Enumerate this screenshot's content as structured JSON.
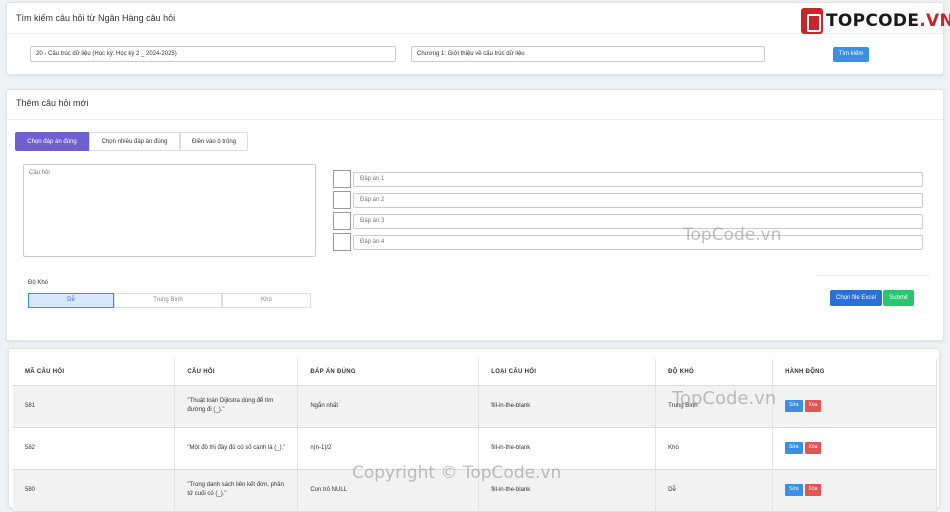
{
  "search": {
    "title": "Tìm kiếm câu hỏi từ Ngân Hàng câu hỏi",
    "course": "20 - Cấu trúc dữ liệu (Học kỳ: Học kỳ 2 _ 2024-2025)",
    "chapter": "Chương 1: Giới thiệu về cấu trúc dữ liệu",
    "button": "Tìm kiếm"
  },
  "logo": {
    "text_main": "TOPCODE",
    "text_suffix": ".VN"
  },
  "add_question": {
    "title": "Thêm câu hỏi mới",
    "tabs": [
      {
        "label": "Chọn đáp án đúng",
        "active": true
      },
      {
        "label": "Chọn nhiều đáp án đúng",
        "active": false
      },
      {
        "label": "Điền vào ô trống",
        "active": false
      }
    ],
    "question_placeholder": "Câu hỏi",
    "answers": [
      {
        "placeholder": "Đáp án 1"
      },
      {
        "placeholder": "Đáp án 2"
      },
      {
        "placeholder": "Đáp án 3"
      },
      {
        "placeholder": "Đáp án 4"
      }
    ],
    "difficulty_label": "Độ Khó",
    "difficulty_options": [
      "Dễ",
      "Trung Bình",
      "Khó"
    ],
    "difficulty_selected": "Dễ",
    "excel_button": "Chọn file Excel",
    "submit_button": "Submit"
  },
  "table": {
    "headers": [
      "MÃ CÂU HỎI",
      "CÂU HỎI",
      "ĐÁP ÁN ĐÚNG",
      "LOẠI CÂU HỎI",
      "ĐỘ KHÓ",
      "HÀNH ĐỘNG"
    ],
    "rows": [
      {
        "id": "581",
        "question": "\"Thuật toán Dijkstra dùng để tìm đường đi (_).\"",
        "answer": "Ngắn nhất",
        "type": "fill-in-the-blank",
        "difficulty": "Trung Bình",
        "edit": "Sửa",
        "delete": "Xóa"
      },
      {
        "id": "582",
        "question": "\"Một đồ thị đầy đủ có số cạnh là (_).\"",
        "answer": "n(n-1)/2",
        "type": "fill-in-the-blank",
        "difficulty": "Khó",
        "edit": "Sửa",
        "delete": "Xóa"
      },
      {
        "id": "580",
        "question": "\"Trong danh sách liên kết đơn, phần tử cuối có (_).\"",
        "answer": "Con trỏ NULL",
        "type": "fill-in-the-blank",
        "difficulty": "Dễ",
        "edit": "Sửa",
        "delete": "Xóa"
      }
    ]
  },
  "watermarks": [
    "TopCode.vn",
    "TopCode.vn",
    "Copyright © TopCode.vn"
  ]
}
